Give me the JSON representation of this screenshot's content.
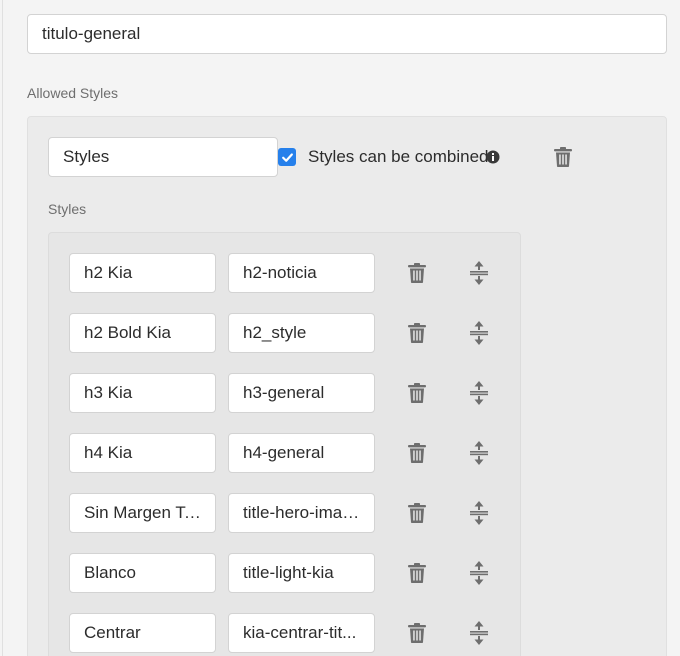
{
  "header_field": {
    "value": "titulo-general"
  },
  "allowed_styles": {
    "label": "Allowed Styles",
    "group_name_value": "Styles",
    "combine_checkbox": {
      "label": "Styles can be combined",
      "checked": true
    },
    "styles_label": "Styles",
    "rows": [
      {
        "name": "h2 Kia",
        "class": "h2-noticia"
      },
      {
        "name": "h2 Bold Kia",
        "class": "h2_style"
      },
      {
        "name": "h3 Kia",
        "class": "h3-general"
      },
      {
        "name": "h4 Kia",
        "class": "h4-general"
      },
      {
        "name": "Sin Margen Top",
        "class": "title-hero-image"
      },
      {
        "name": "Blanco",
        "class": "title-light-kia"
      },
      {
        "name": "Centrar",
        "class": "kia-centrar-tit..."
      }
    ]
  },
  "icons": {
    "delete": "trash-icon",
    "reorder": "drag-handle-icon",
    "info": "info-icon",
    "check": "checkmark-icon"
  },
  "colors": {
    "accent": "#2680eb",
    "icon": "#6e6e6e",
    "panel_bg": "#ebebeb",
    "field_border": "#d3d3d3"
  }
}
